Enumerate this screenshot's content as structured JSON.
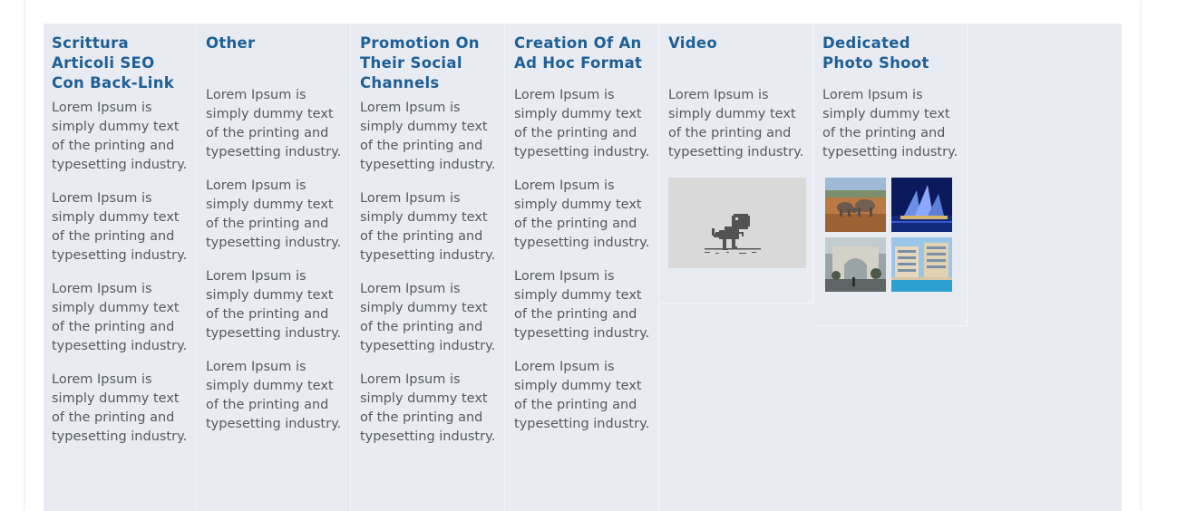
{
  "columns": [
    {
      "title": "Scrittura Articoli SEO Con Back-Link",
      "paragraphs": [
        "Lorem Ipsum is simply dummy text of the printing and typesetting industry.",
        "Lorem Ipsum is simply dummy text of the printing and typesetting industry.",
        "Lorem Ipsum is simply dummy text of the printing and typesetting industry.",
        "Lorem Ipsum is simply dummy text of the printing and typesetting industry."
      ]
    },
    {
      "title": "Other",
      "paragraphs": [
        "Lorem Ipsum is simply dummy text of the printing and typesetting industry.",
        "Lorem Ipsum is simply dummy text of the printing and typesetting industry.",
        "Lorem Ipsum is simply dummy text of the printing and typesetting industry.",
        "Lorem Ipsum is simply dummy text of the printing and typesetting industry."
      ]
    },
    {
      "title": "Promotion On Their Social Channels",
      "paragraphs": [
        "Lorem Ipsum is simply dummy text of the printing and typesetting industry.",
        "Lorem Ipsum is simply dummy text of the printing and typesetting industry.",
        "Lorem Ipsum is simply dummy text of the printing and typesetting industry.",
        "Lorem Ipsum is simply dummy text of the printing and typesetting industry."
      ]
    },
    {
      "title": "Creation Of An Ad Hoc Format",
      "paragraphs": [
        "Lorem Ipsum is simply dummy text of the printing and typesetting industry.",
        "Lorem Ipsum is simply dummy text of the printing and typesetting industry.",
        "Lorem Ipsum is simply dummy text of the printing and typesetting industry.",
        "Lorem Ipsum is simply dummy text of the printing and typesetting industry."
      ]
    },
    {
      "title": "Video",
      "paragraphs": [
        "Lorem Ipsum is simply dummy text of the printing and typesetting industry."
      ],
      "media": "video-placeholder-dinosaur"
    },
    {
      "title": "Dedicated Photo Shoot",
      "paragraphs": [
        "Lorem Ipsum is simply dummy text of the printing and typesetting industry."
      ],
      "gallery": [
        "elephants-photo",
        "opera-house-photo",
        "arch-photo",
        "resort-photo"
      ]
    }
  ],
  "colors": {
    "panel_bg": "#e8ecf2",
    "title": "#1f5f98",
    "body_text": "#555a60",
    "video_bg": "#d9d9d9",
    "dino": "#535353"
  }
}
